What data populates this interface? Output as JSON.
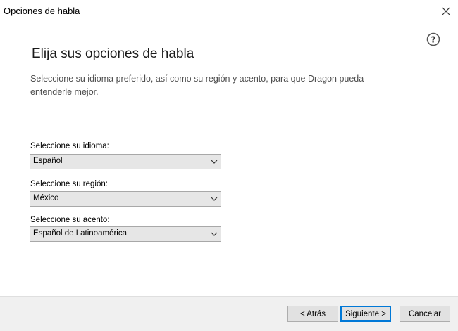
{
  "window": {
    "title": "Opciones de habla",
    "close_icon": "close-icon",
    "help_icon": "question-circle-icon"
  },
  "main": {
    "heading": "Elija sus opciones de habla",
    "description": "Seleccione su idioma preferido, así como su región y acento, para que Dragon pueda entenderle mejor."
  },
  "fields": {
    "language": {
      "label": "Seleccione su idioma:",
      "value": "Español"
    },
    "region": {
      "label": "Seleccione su región:",
      "value": "México"
    },
    "accent": {
      "label": "Seleccione su acento:",
      "value": "Español de Latinoamérica"
    }
  },
  "footer": {
    "back_label": "< Atrás",
    "next_label": "Siguiente >",
    "cancel_label": "Cancelar"
  },
  "colors": {
    "accent": "#0078d7",
    "footer_background": "#f0f0f0"
  }
}
